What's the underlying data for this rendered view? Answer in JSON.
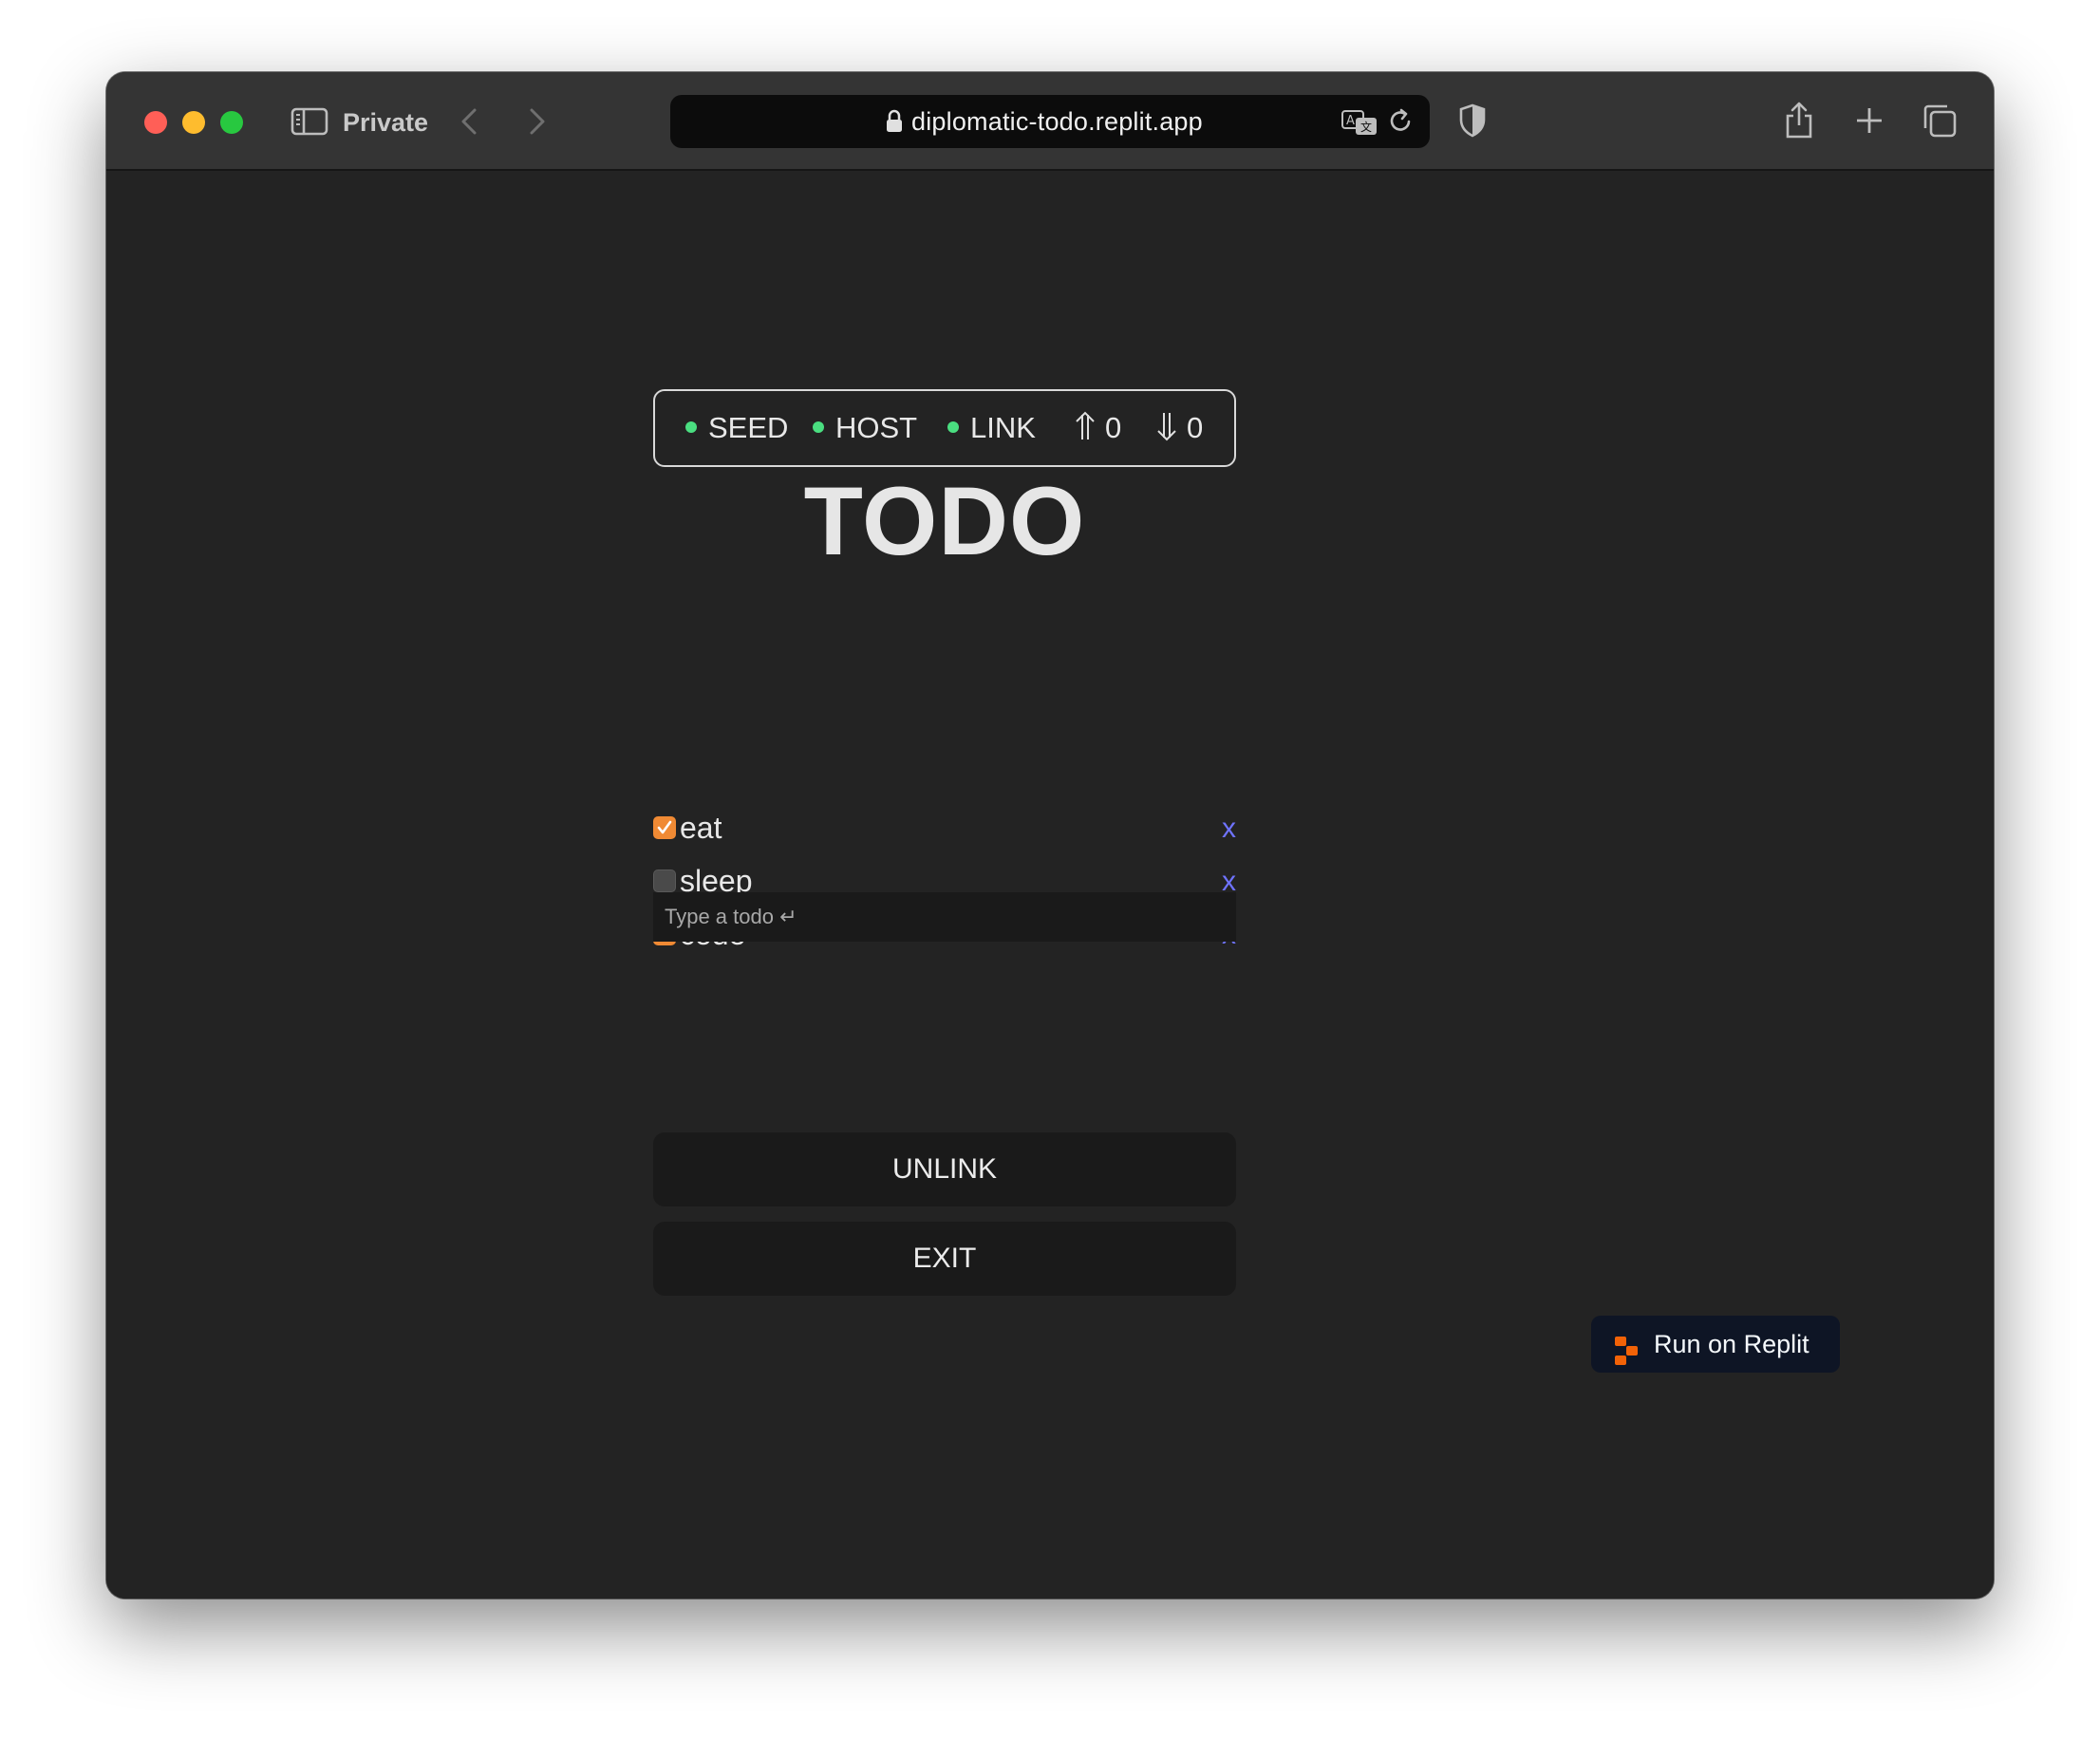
{
  "browser": {
    "mode_label": "Private",
    "url": "diplomatic-todo.replit.app"
  },
  "status": {
    "seed": "SEED",
    "host": "HOST",
    "link": "LINK",
    "up_count": "0",
    "down_count": "0",
    "indicator_color": "#4ade80"
  },
  "app": {
    "title": "TODO",
    "todos": [
      {
        "text": "eat",
        "done": true,
        "remove_label": "x"
      },
      {
        "text": "sleep",
        "done": false,
        "remove_label": "x"
      },
      {
        "text": "code",
        "done": true,
        "remove_label": "x"
      }
    ],
    "input_placeholder": "Type a todo ↵",
    "unlink_label": "UNLINK",
    "exit_label": "EXIT"
  },
  "replit": {
    "label": "Run on Replit",
    "accent": "#f26207"
  },
  "colors": {
    "checkbox_checked": "#f08a34",
    "remove_link": "#6f73ff",
    "background": "#232323"
  }
}
